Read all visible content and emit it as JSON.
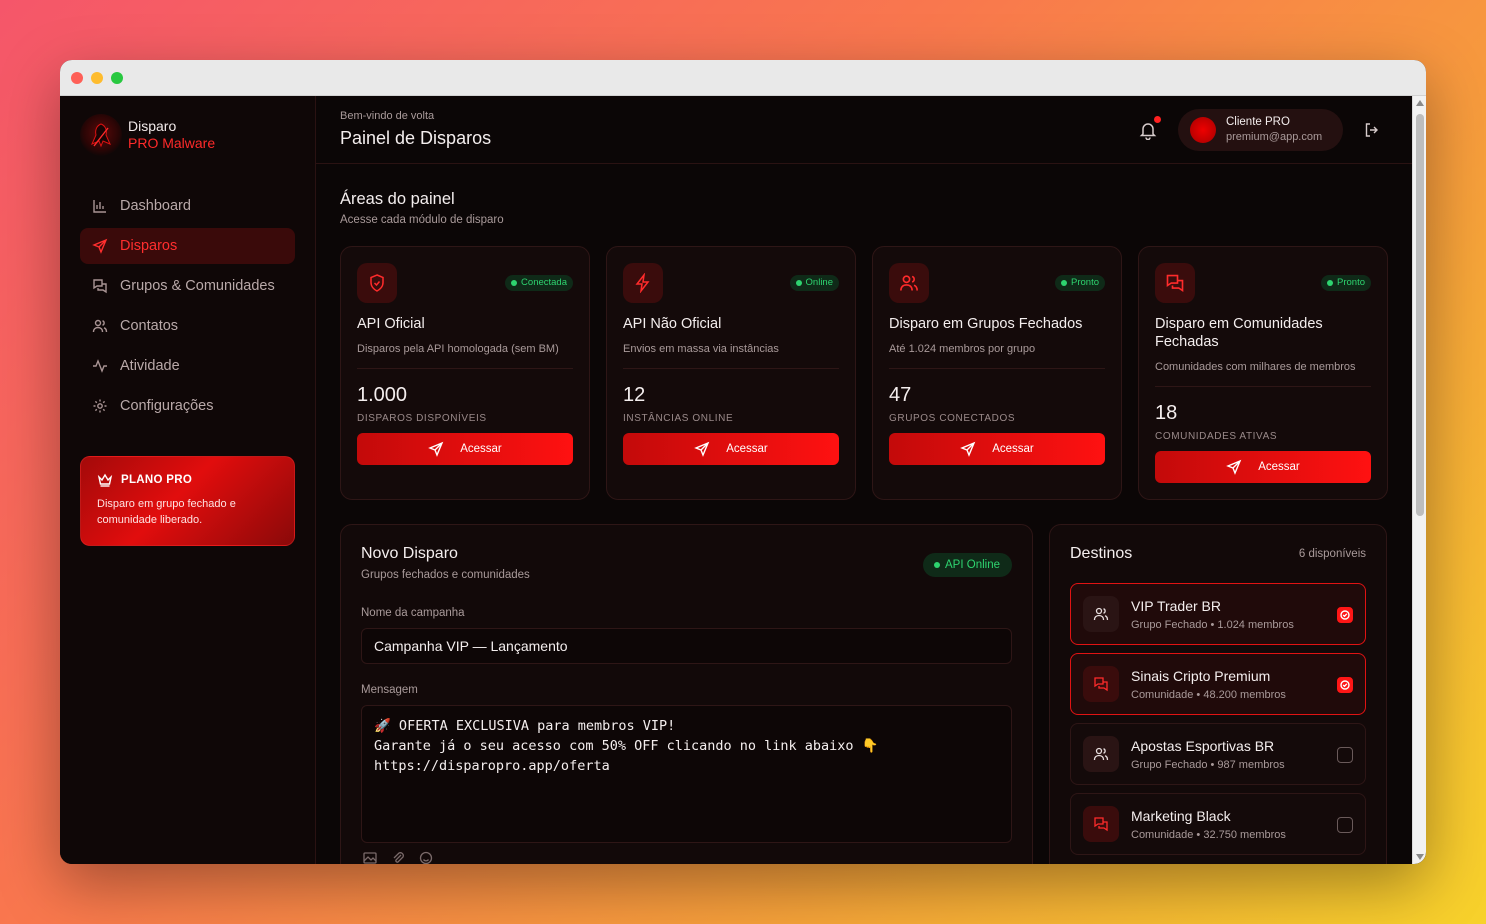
{
  "brand": {
    "name": "Disparo",
    "sub": "PRO Malware",
    "logo_icon": "hooded-figure-icon"
  },
  "nav": [
    {
      "label": "Dashboard",
      "icon": "bar-chart-icon",
      "active": false
    },
    {
      "label": "Disparos",
      "icon": "send-icon",
      "active": true
    },
    {
      "label": "Grupos & Comunidades",
      "icon": "messages-icon",
      "active": false
    },
    {
      "label": "Contatos",
      "icon": "users-icon",
      "active": false
    },
    {
      "label": "Atividade",
      "icon": "activity-icon",
      "active": false
    },
    {
      "label": "Configurações",
      "icon": "gear-icon",
      "active": false
    }
  ],
  "plan": {
    "title": "PLANO PRO",
    "text": "Disparo em grupo fechado e comunidade liberado."
  },
  "header": {
    "welcome": "Bem-vindo de volta",
    "title": "Painel de Disparos",
    "user_name": "Cliente PRO",
    "user_email": "premium@app.com"
  },
  "areas": {
    "title": "Áreas do painel",
    "subtitle": "Acesse cada módulo de disparo",
    "cards": [
      {
        "title": "API Oficial",
        "desc": "Disparos pela API homologada (sem BM)",
        "badge": "Conectada",
        "value": "1.000",
        "label": "DISPAROS DISPONÍVEIS",
        "button": "Acessar",
        "icon": "shield-icon"
      },
      {
        "title": "API Não Oficial",
        "desc": "Envios em massa via instâncias",
        "badge": "Online",
        "value": "12",
        "label": "INSTÂNCIAS ONLINE",
        "button": "Acessar",
        "icon": "bolt-icon"
      },
      {
        "title": "Disparo em Grupos Fechados",
        "desc": "Até 1.024 membros por grupo",
        "badge": "Pronto",
        "value": "47",
        "label": "GRUPOS CONECTADOS",
        "button": "Acessar",
        "icon": "users-icon"
      },
      {
        "title": "Disparo em Comunidades Fechadas",
        "desc": "Comunidades com milhares de membros",
        "badge": "Pronto",
        "value": "18",
        "label": "COMUNIDADES ATIVAS",
        "button": "Acessar",
        "icon": "messages-icon"
      }
    ]
  },
  "new_dispatch": {
    "title": "Novo Disparo",
    "subtitle": "Grupos fechados e comunidades",
    "status": "API Online",
    "campaign_label": "Nome da campanha",
    "campaign_value": "Campanha VIP — Lançamento",
    "message_label": "Mensagem",
    "message_lines": [
      "🚀 OFERTA EXCLUSIVA para membros VIP!",
      "",
      "Garante já o seu acesso com 50% OFF clicando no link abaixo 👇",
      "",
      "https://disparopro.app/oferta"
    ]
  },
  "destinations": {
    "title": "Destinos",
    "count": "6 disponíveis",
    "items": [
      {
        "name": "VIP Trader BR",
        "meta": "Grupo Fechado • 1.024 membros",
        "type": "group",
        "selected": true
      },
      {
        "name": "Sinais Cripto Premium",
        "meta": "Comunidade • 48.200 membros",
        "type": "community",
        "selected": true
      },
      {
        "name": "Apostas Esportivas BR",
        "meta": "Grupo Fechado • 987 membros",
        "type": "group",
        "selected": false
      },
      {
        "name": "Marketing Black",
        "meta": "Comunidade • 32.750 membros",
        "type": "community",
        "selected": false
      }
    ]
  },
  "colors": {
    "accent": "#ff1616",
    "success": "#2ed36f",
    "background": "#0b0606"
  }
}
